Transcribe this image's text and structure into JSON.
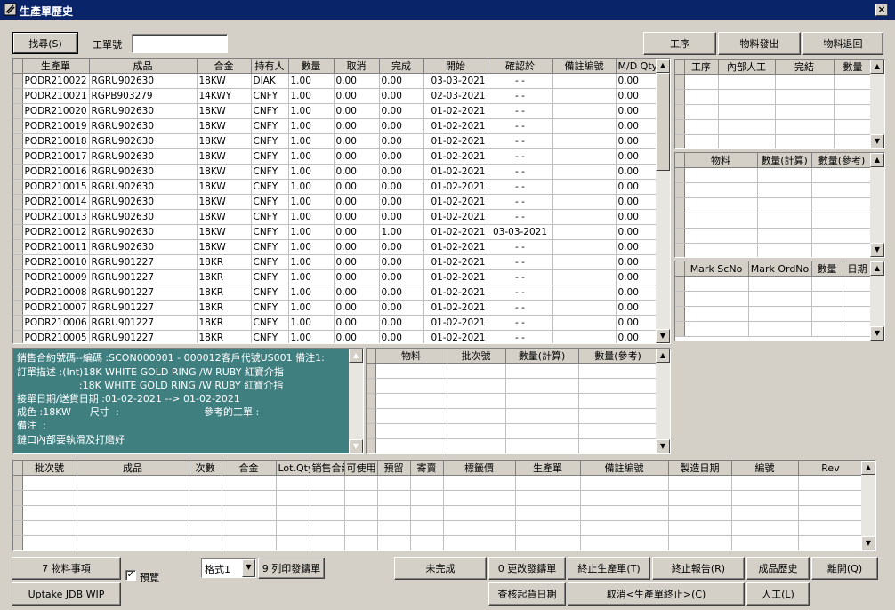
{
  "window": {
    "title": "生產單歷史",
    "close_label": "×"
  },
  "toolbar": {
    "search_label": "找尋(S)",
    "work_no_label": "工單號",
    "work_no_value": "",
    "process_label": "工序",
    "material_issue_label": "物料發出",
    "material_return_label": "物料退回"
  },
  "main_grid": {
    "columns": [
      "生產單",
      "成品",
      "合金",
      "持有人",
      "數量",
      "取消",
      "完成",
      "開始",
      "確認於",
      "備註編號",
      "M/D Qty"
    ],
    "rows": [
      [
        "PODR210022",
        "RGRU902630",
        "18KW",
        "DIAK",
        "1.00",
        "0.00",
        "0.00",
        "03-03-2021",
        "- -",
        "",
        "0.00"
      ],
      [
        "PODR210021",
        "RGPB903279",
        "14KWY",
        "CNFY",
        "1.00",
        "0.00",
        "0.00",
        "02-03-2021",
        "- -",
        "",
        "0.00"
      ],
      [
        "PODR210020",
        "RGRU902630",
        "18KW",
        "CNFY",
        "1.00",
        "0.00",
        "0.00",
        "01-02-2021",
        "- -",
        "",
        "0.00"
      ],
      [
        "PODR210019",
        "RGRU902630",
        "18KW",
        "CNFY",
        "1.00",
        "0.00",
        "0.00",
        "01-02-2021",
        "- -",
        "",
        "0.00"
      ],
      [
        "PODR210018",
        "RGRU902630",
        "18KW",
        "CNFY",
        "1.00",
        "0.00",
        "0.00",
        "01-02-2021",
        "- -",
        "",
        "0.00"
      ],
      [
        "PODR210017",
        "RGRU902630",
        "18KW",
        "CNFY",
        "1.00",
        "0.00",
        "0.00",
        "01-02-2021",
        "- -",
        "",
        "0.00"
      ],
      [
        "PODR210016",
        "RGRU902630",
        "18KW",
        "CNFY",
        "1.00",
        "0.00",
        "0.00",
        "01-02-2021",
        "- -",
        "",
        "0.00"
      ],
      [
        "PODR210015",
        "RGRU902630",
        "18KW",
        "CNFY",
        "1.00",
        "0.00",
        "0.00",
        "01-02-2021",
        "- -",
        "",
        "0.00"
      ],
      [
        "PODR210014",
        "RGRU902630",
        "18KW",
        "CNFY",
        "1.00",
        "0.00",
        "0.00",
        "01-02-2021",
        "- -",
        "",
        "0.00"
      ],
      [
        "PODR210013",
        "RGRU902630",
        "18KW",
        "CNFY",
        "1.00",
        "0.00",
        "0.00",
        "01-02-2021",
        "- -",
        "",
        "0.00"
      ],
      [
        "PODR210012",
        "RGRU902630",
        "18KW",
        "CNFY",
        "1.00",
        "0.00",
        "1.00",
        "01-02-2021",
        "03-03-2021",
        "",
        "0.00"
      ],
      [
        "PODR210011",
        "RGRU902630",
        "18KW",
        "CNFY",
        "1.00",
        "0.00",
        "0.00",
        "01-02-2021",
        "- -",
        "",
        "0.00"
      ],
      [
        "PODR210010",
        "RGRU901227",
        "18KR",
        "CNFY",
        "1.00",
        "0.00",
        "0.00",
        "01-02-2021",
        "- -",
        "",
        "0.00"
      ],
      [
        "PODR210009",
        "RGRU901227",
        "18KR",
        "CNFY",
        "1.00",
        "0.00",
        "0.00",
        "01-02-2021",
        "- -",
        "",
        "0.00"
      ],
      [
        "PODR210008",
        "RGRU901227",
        "18KR",
        "CNFY",
        "1.00",
        "0.00",
        "0.00",
        "01-02-2021",
        "- -",
        "",
        "0.00"
      ],
      [
        "PODR210007",
        "RGRU901227",
        "18KR",
        "CNFY",
        "1.00",
        "0.00",
        "0.00",
        "01-02-2021",
        "- -",
        "",
        "0.00"
      ],
      [
        "PODR210006",
        "RGRU901227",
        "18KR",
        "CNFY",
        "1.00",
        "0.00",
        "0.00",
        "01-02-2021",
        "- -",
        "",
        "0.00"
      ],
      [
        "PODR210005",
        "RGRU901227",
        "18KR",
        "CNFY",
        "1.00",
        "0.00",
        "0.00",
        "01-02-2021",
        "- -",
        "",
        "0.00"
      ]
    ]
  },
  "process_grid": {
    "columns": [
      "工序",
      "內部人工",
      "完結",
      "數量"
    ]
  },
  "material_grid": {
    "columns": [
      "物料",
      "數量(計算)",
      "數量(參考)"
    ]
  },
  "mark_grid": {
    "columns": [
      "Mark ScNo",
      "Mark OrdNo",
      "數量",
      "日期"
    ]
  },
  "info": {
    "lines": [
      "銷售合約號碼--編碼 :SCON000001 - 000012客戶代號US001  備注1:",
      "訂單描述  :(Int)18K WHITE GOLD RING /W RUBY 紅寶介指",
      "                    :18K WHITE GOLD RING /W RUBY 紅寶介指",
      "接單日期/送貨日期 :01-02-2021 --> 01-02-2021",
      "成色 :18KW      尺寸  :",
      "參考的工單  :",
      "備注  :",
      "鏈口內部要執滑及打磨好"
    ]
  },
  "mid_material_grid": {
    "columns": [
      "物料",
      "批次號",
      "數量(計算)",
      "數量(參考)"
    ]
  },
  "lot_grid": {
    "columns": [
      "批次號",
      "成品",
      "次數",
      "合金",
      "Lot.Qty",
      "销售合约",
      "可使用",
      "預留",
      "寄賣",
      "標籤價",
      "生產單",
      "備註編號",
      "製造日期",
      "編號",
      "Rev"
    ]
  },
  "bottom": {
    "material_items_label": "7 物料事項",
    "uptake_label": "Uptake JDB WIP",
    "preview_label": "預覽",
    "preview_checked": "✓",
    "format_value": "格式1",
    "print_label": "9 列印發鑄單",
    "incomplete_label": "未完成",
    "change_label": "0 更改發鑄單",
    "stop_order_label": "終止生產單(T)",
    "stop_report_label": "終止報告(R)",
    "product_history_label": "成品歷史",
    "leave_label": "離開(Q)",
    "verify_date_label": "查核起貨日期",
    "cancel_stop_label": "取消<生產單終止>(C)",
    "labor_label": "人工(L)"
  }
}
